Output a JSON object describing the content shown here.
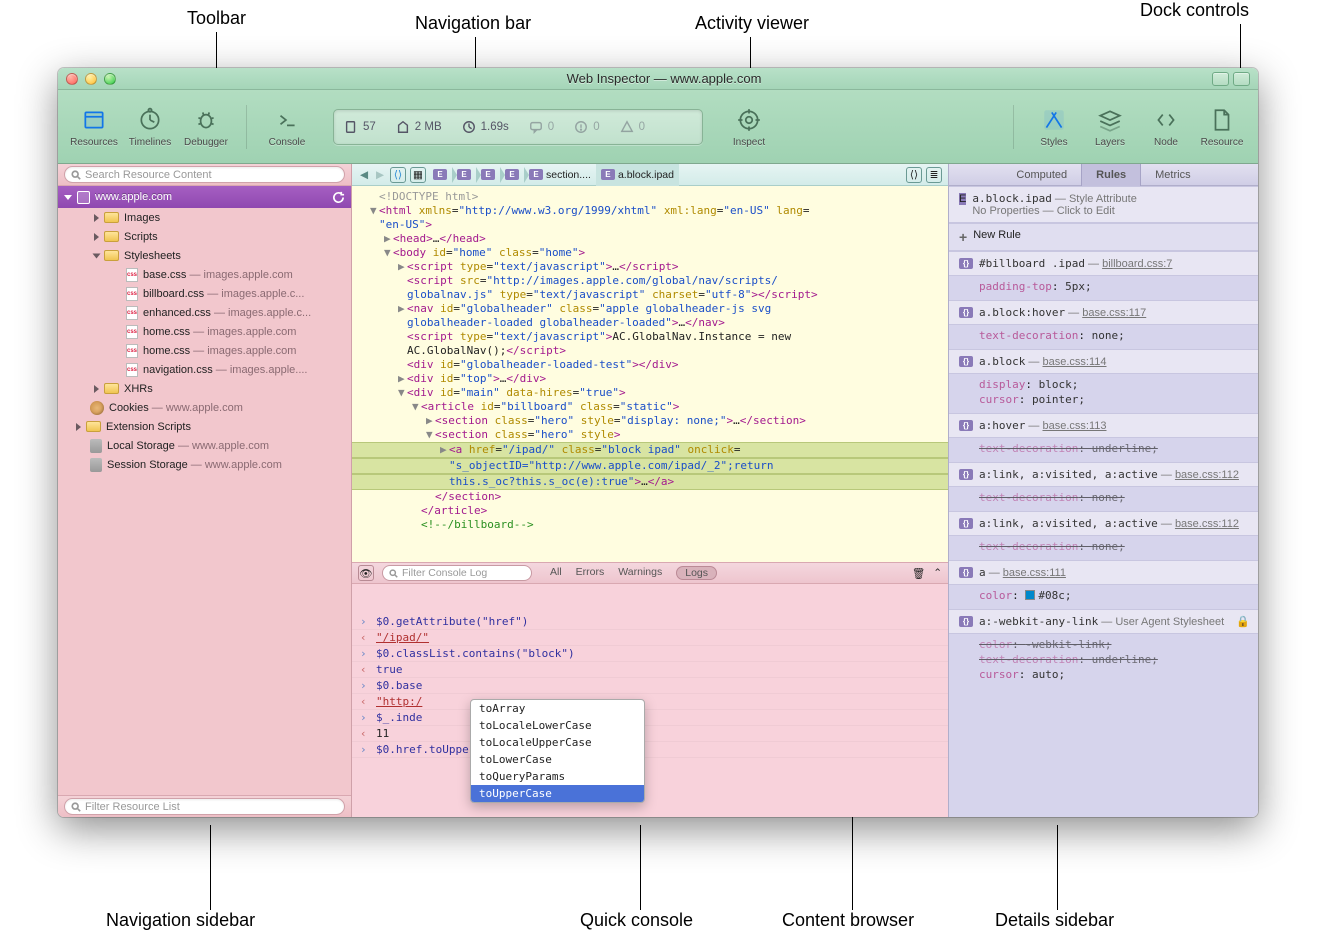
{
  "annotations": {
    "toolbar": "Toolbar",
    "navbar": "Navigation bar",
    "activity": "Activity viewer",
    "dock": "Dock controls",
    "navsidebar": "Navigation sidebar",
    "quickconsole": "Quick console",
    "contentbrowser": "Content browser",
    "detailssidebar": "Details sidebar"
  },
  "title": "Web Inspector — www.apple.com",
  "toolbar": {
    "resources": "Resources",
    "timelines": "Timelines",
    "debugger": "Debugger",
    "console": "Console",
    "inspect": "Inspect",
    "styles": "Styles",
    "layers": "Layers",
    "node": "Node",
    "resource": "Resource"
  },
  "activity": {
    "docs": "57",
    "size": "2 MB",
    "time": "1.69s",
    "msgs": "0",
    "warns": "0",
    "errs": "0"
  },
  "sidebar": {
    "search_placeholder": "Search Resource Content",
    "filter_placeholder": "Filter Resource List",
    "root": {
      "label": "www.apple.com"
    },
    "items": [
      {
        "type": "folder",
        "label": "Images",
        "indent": 1,
        "disc": "closed"
      },
      {
        "type": "folder",
        "label": "Scripts",
        "indent": 1,
        "disc": "closed"
      },
      {
        "type": "folder",
        "label": "Stylesheets",
        "indent": 1,
        "disc": "open"
      },
      {
        "type": "css",
        "label": "base.css",
        "sub": " — images.apple.com",
        "indent": 2
      },
      {
        "type": "css",
        "label": "billboard.css",
        "sub": " — images.apple.c...",
        "indent": 2
      },
      {
        "type": "css",
        "label": "enhanced.css",
        "sub": " — images.apple.c...",
        "indent": 2
      },
      {
        "type": "css",
        "label": "home.css",
        "sub": " — images.apple.com",
        "indent": 2
      },
      {
        "type": "css",
        "label": "home.css",
        "sub": " — images.apple.com",
        "indent": 2
      },
      {
        "type": "css",
        "label": "navigation.css",
        "sub": " — images.apple....",
        "indent": 2
      },
      {
        "type": "folder",
        "label": "XHRs",
        "indent": 1,
        "disc": "closed"
      },
      {
        "type": "cookie",
        "label": "Cookies",
        "sub": " — www.apple.com",
        "indent": 0
      },
      {
        "type": "folder",
        "label": "Extension Scripts",
        "indent": 0,
        "disc": "closed"
      },
      {
        "type": "db",
        "label": "Local Storage",
        "sub": " — www.apple.com",
        "indent": 0
      },
      {
        "type": "db",
        "label": "Session Storage",
        "sub": " — www.apple.com",
        "indent": 0
      }
    ]
  },
  "breadcrumbs": [
    "E",
    "E",
    "E",
    "E",
    "E section....",
    "E a.block.ipad"
  ],
  "dom": [
    {
      "i": 1,
      "d": "",
      "html": "<span class='t-doc'>&lt;!DOCTYPE html&gt;</span>"
    },
    {
      "i": 1,
      "d": "▼",
      "html": "<span class='t-tag'>&lt;html</span> <span class='t-attr'>xmlns</span>=<span class='t-str'>\"http://www.w3.org/1999/xhtml\"</span> <span class='t-attr'>xml:lang</span>=<span class='t-str'>\"en-US\"</span> <span class='t-attr'>lang</span>="
    },
    {
      "i": 1,
      "d": "",
      "html": "<span class='t-str'>\"en-US\"</span><span class='t-tag'>&gt;</span>"
    },
    {
      "i": 2,
      "d": "▶",
      "html": "<span class='t-tag'>&lt;head&gt;</span>…<span class='t-tag'>&lt;/head&gt;</span>"
    },
    {
      "i": 2,
      "d": "▼",
      "html": "<span class='t-tag'>&lt;body</span> <span class='t-attr'>id</span>=<span class='t-str'>\"home\"</span> <span class='t-attr'>class</span>=<span class='t-str'>\"home\"</span><span class='t-tag'>&gt;</span>"
    },
    {
      "i": 3,
      "d": "▶",
      "html": "<span class='t-tag'>&lt;script</span> <span class='t-attr'>type</span>=<span class='t-str'>\"text/javascript\"</span><span class='t-tag'>&gt;</span>…<span class='t-tag'>&lt;/script&gt;</span>"
    },
    {
      "i": 3,
      "d": "",
      "html": "<span class='t-tag'>&lt;script</span> <span class='t-attr'>src</span>=<span class='t-str'>\"http://images.apple.com/global/nav/scripts/</span>"
    },
    {
      "i": 3,
      "d": "",
      "html": "<span class='t-str'>globalnav.js\"</span> <span class='t-attr'>type</span>=<span class='t-str'>\"text/javascript\"</span> <span class='t-attr'>charset</span>=<span class='t-str'>\"utf-8\"</span><span class='t-tag'>&gt;&lt;/script&gt;</span>"
    },
    {
      "i": 3,
      "d": "▶",
      "html": "<span class='t-tag'>&lt;nav</span> <span class='t-attr'>id</span>=<span class='t-str'>\"globalheader\"</span> <span class='t-attr'>class</span>=<span class='t-str'>\"apple globalheader-js svg</span>"
    },
    {
      "i": 3,
      "d": "",
      "html": "<span class='t-str'>globalheader-loaded globalheader-loaded\"</span><span class='t-tag'>&gt;</span>…<span class='t-tag'>&lt;/nav&gt;</span>"
    },
    {
      "i": 3,
      "d": "",
      "html": "<span class='t-tag'>&lt;script</span> <span class='t-attr'>type</span>=<span class='t-str'>\"text/javascript\"</span><span class='t-tag'>&gt;</span>AC.GlobalNav.Instance = new"
    },
    {
      "i": 3,
      "d": "",
      "html": "AC.GlobalNav();<span class='t-tag'>&lt;/script&gt;</span>"
    },
    {
      "i": 3,
      "d": "",
      "html": "<span class='t-tag'>&lt;div</span> <span class='t-attr'>id</span>=<span class='t-str'>\"globalheader-loaded-test\"</span><span class='t-tag'>&gt;&lt;/div&gt;</span>"
    },
    {
      "i": 3,
      "d": "▶",
      "html": "<span class='t-tag'>&lt;div</span> <span class='t-attr'>id</span>=<span class='t-str'>\"top\"</span><span class='t-tag'>&gt;</span>…<span class='t-tag'>&lt;/div&gt;</span>"
    },
    {
      "i": 3,
      "d": "▼",
      "html": "<span class='t-tag'>&lt;div</span> <span class='t-attr'>id</span>=<span class='t-str'>\"main\"</span> <span class='t-attr'>data-hires</span>=<span class='t-str'>\"true\"</span><span class='t-tag'>&gt;</span>"
    },
    {
      "i": 4,
      "d": "▼",
      "html": "<span class='t-tag'>&lt;article</span> <span class='t-attr'>id</span>=<span class='t-str'>\"billboard\"</span> <span class='t-attr'>class</span>=<span class='t-str'>\"static\"</span><span class='t-tag'>&gt;</span>"
    },
    {
      "i": 5,
      "d": "▶",
      "html": "<span class='t-tag'>&lt;section</span> <span class='t-attr'>class</span>=<span class='t-str'>\"hero\"</span> <span class='t-attr'>style</span>=<span class='t-str'>\"display: none;\"</span><span class='t-tag'>&gt;</span>…<span class='t-tag'>&lt;/section&gt;</span>"
    },
    {
      "i": 5,
      "d": "▼",
      "html": "<span class='t-tag'>&lt;section</span> <span class='t-attr'>class</span>=<span class='t-str'>\"hero\"</span> <span class='t-attr'>style</span><span class='t-tag'>&gt;</span>"
    },
    {
      "i": 6,
      "d": "▶",
      "html": "<span class='t-tag'>&lt;a</span> <span class='t-attr'>href</span>=<span class='t-str'>\"/ipad/\"</span> <span class='t-attr'>class</span>=<span class='t-str'>\"block ipad\"</span> <span class='t-attr'>onclick</span>=",
      "sel": true
    },
    {
      "i": 6,
      "d": "",
      "html": "<span class='t-str'>\"s_objectID=\"http://www.apple.com/ipad/_2\";return</span>",
      "sel": true
    },
    {
      "i": 6,
      "d": "",
      "html": "<span class='t-str'>this.s_oc?this.s_oc(e):true\"</span><span class='t-tag'>&gt;</span>…<span class='t-tag'>&lt;/a&gt;</span>",
      "sel": true
    },
    {
      "i": 5,
      "d": "",
      "html": "<span class='t-tag'>&lt;/section&gt;</span>"
    },
    {
      "i": 4,
      "d": "",
      "html": "<span class='t-tag'>&lt;/article&gt;</span>"
    },
    {
      "i": 4,
      "d": "",
      "html": "<span class='t-cm'>&lt;!--/billboard--&gt;</span>"
    }
  ],
  "console": {
    "filter_placeholder": "Filter Console Log",
    "tabs": [
      "All",
      "Errors",
      "Warnings",
      "Logs"
    ],
    "selected_tab": 3,
    "lines": [
      {
        "t": "in",
        "txt": "$0.getAttribute(\"href\")"
      },
      {
        "t": "out",
        "txt": "\"/ipad/\"",
        "cls": "c-str"
      },
      {
        "t": "in",
        "txt": "$0.classList.contains(\"block\")"
      },
      {
        "t": "out",
        "txt": "true",
        "cls": "c-bool"
      },
      {
        "t": "in",
        "txt": "$0.base"
      },
      {
        "t": "out",
        "txt": "\"http:/",
        "cls": "c-str"
      },
      {
        "t": "in",
        "txt": "$_.inde"
      },
      {
        "t": "out",
        "txt": "11",
        "cls": "c-lit"
      },
      {
        "t": "in",
        "txt": "$0.href.toUpperCase",
        "ghost": "UpperCase"
      }
    ],
    "autocomplete": [
      "toArray",
      "toLocaleLowerCase",
      "toLocaleUpperCase",
      "toLowerCase",
      "toQueryParams",
      "toUpperCase"
    ],
    "autocomplete_selected": 5
  },
  "details": {
    "tabs": [
      "Computed",
      "Rules",
      "Metrics"
    ],
    "selected_tab": 1,
    "header": {
      "selector": "a.block.ipad",
      "src": "Style Attribute",
      "sub": "No Properties — Click to Edit"
    },
    "newrule": "New Rule",
    "rules": [
      {
        "sel": "#billboard .ipad",
        "src": "billboard.css:7",
        "props": [
          {
            "p": "padding-top",
            "v": "5px;"
          }
        ]
      },
      {
        "sel": "a.block:hover",
        "src": "base.css:117",
        "props": [
          {
            "p": "text-decoration",
            "v": "none;"
          }
        ]
      },
      {
        "sel": "a.block",
        "src": "base.css:114",
        "props": [
          {
            "p": "display",
            "v": "block;"
          },
          {
            "p": "cursor",
            "v": "pointer;"
          }
        ]
      },
      {
        "sel": "a:hover",
        "src": "base.css:113",
        "props": [
          {
            "p": "text-decoration",
            "v": "underline;",
            "strike": true
          }
        ]
      },
      {
        "sel": "a:link, a:visited, a:active",
        "src": "base.css:112",
        "props": [
          {
            "p": "text-decoration",
            "v": "none;",
            "strike": true
          }
        ]
      },
      {
        "sel": "a:link, a:visited, a:active",
        "src": "base.css:112",
        "props": [
          {
            "p": "text-decoration",
            "v": "none;",
            "strike": true
          }
        ]
      },
      {
        "sel": "a",
        "src": "base.css:111",
        "props": [
          {
            "p": "color",
            "v": "#08c;",
            "swatch": "#0088cc"
          }
        ]
      },
      {
        "sel": "a:-webkit-any-link",
        "src": "User Agent Stylesheet",
        "locked": true,
        "props": [
          {
            "p": "color",
            "v": "-webkit-link;",
            "strike": true
          },
          {
            "p": "text-decoration",
            "v": "underline;",
            "strike": true
          },
          {
            "p": "cursor",
            "v": "auto;"
          }
        ]
      }
    ]
  }
}
